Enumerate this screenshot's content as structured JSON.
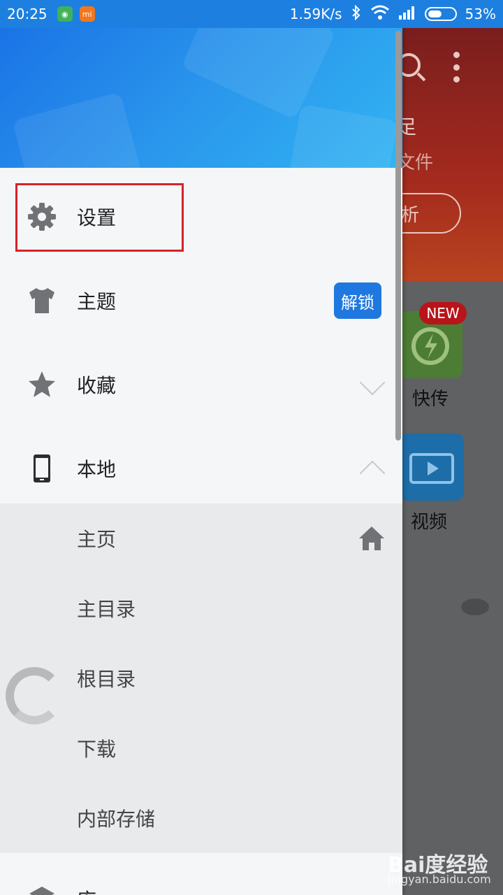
{
  "status_bar": {
    "time": "20:25",
    "network_speed": "1.59K/s",
    "battery_percent": "53%",
    "battery_level": 0.53
  },
  "background_app": {
    "title_fragment": "足",
    "subtitle_fragment": "文件",
    "button_fragment": "析",
    "tile_new_badge": "NEW",
    "tile_label_transfer": "快传",
    "tile_label_video": "视频"
  },
  "drawer": {
    "items": [
      {
        "label": "设置",
        "icon": "gear-icon"
      },
      {
        "label": "主题",
        "icon": "tshirt-icon",
        "badge": "解锁"
      },
      {
        "label": "收藏",
        "icon": "star-icon",
        "expanded": false
      },
      {
        "label": "本地",
        "icon": "phone-icon",
        "expanded": true
      }
    ],
    "local_submenu": [
      {
        "label": "主页"
      },
      {
        "label": "主目录"
      },
      {
        "label": "根目录"
      },
      {
        "label": "下载"
      },
      {
        "label": "内部存储"
      }
    ],
    "partial_item_label": "库"
  },
  "watermark": {
    "brand": "Bai度经验",
    "url": "jingyan.baidu.com"
  },
  "colors": {
    "drawer_header_start": "#1a73e6",
    "drawer_header_end": "#32b4f2",
    "unlock_badge": "#1f78e0",
    "highlight_box": "#d6222a",
    "bg_header": "#a42a1e"
  }
}
